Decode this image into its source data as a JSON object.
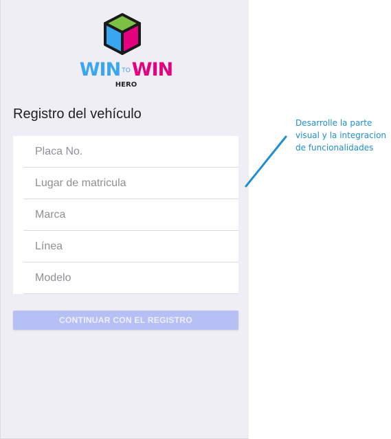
{
  "logo": {
    "word1": "WIN",
    "to": "TO",
    "word2": "WIN",
    "sub": "HERO",
    "colors": {
      "blue": "#3aa6f0",
      "pink": "#e4007e",
      "green": "#7cc143"
    }
  },
  "title": "Registro del vehículo",
  "fields": [
    {
      "placeholder": "Placa No."
    },
    {
      "placeholder": "Lugar de matricula"
    },
    {
      "placeholder": "Marca"
    },
    {
      "placeholder": "Línea"
    },
    {
      "placeholder": "Modelo"
    }
  ],
  "button": {
    "label": "CONTINUAR CON EL REGISTRO",
    "color": "#b7c0f5"
  },
  "annotation": {
    "text": "Desarrolle la parte visual y la integracion de funcionalidades",
    "color": "#1f8fd0"
  }
}
